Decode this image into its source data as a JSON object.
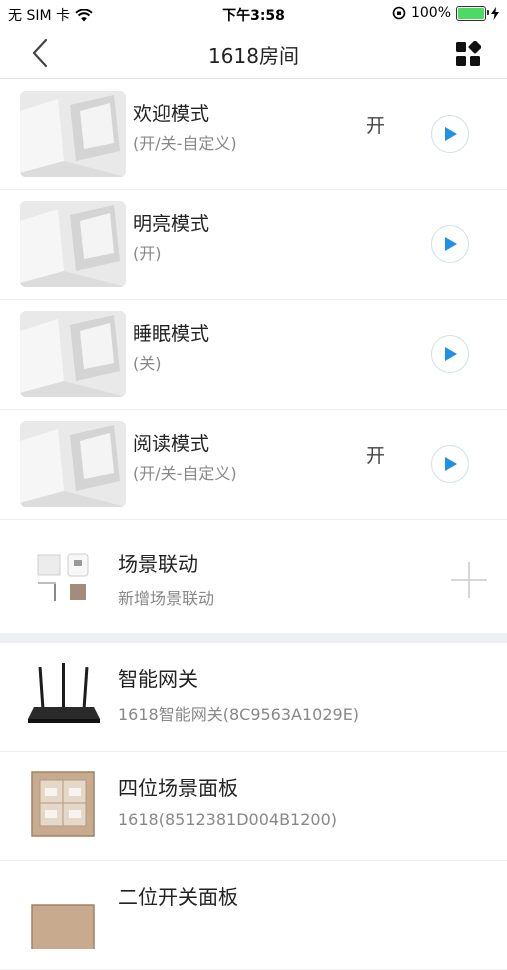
{
  "status_bar": {
    "carrier": "无 SIM 卡",
    "time": "下午3:58",
    "battery": "100%"
  },
  "nav": {
    "title": "1618房间"
  },
  "scenes": [
    {
      "name": "欢迎模式",
      "sub": "(开/关-自定义)",
      "state": "开"
    },
    {
      "name": "明亮模式",
      "sub": "(开)",
      "state": ""
    },
    {
      "name": "睡眠模式",
      "sub": "(关)",
      "state": ""
    },
    {
      "name": "阅读模式",
      "sub": "(开/关-自定义)",
      "state": "开"
    }
  ],
  "scene_link": {
    "name": "场景联动",
    "sub": "新增场景联动"
  },
  "devices": [
    {
      "name": "智能网关",
      "sub": "1618智能网关(8C9563A1029E)"
    },
    {
      "name": "四位场景面板",
      "sub": "1618(8512381D004B1200)"
    },
    {
      "name": "二位开关面板",
      "sub": ""
    }
  ],
  "colors": {
    "accent": "#1e90e6",
    "battery": "#4cd964",
    "band": "#eeeff2"
  }
}
